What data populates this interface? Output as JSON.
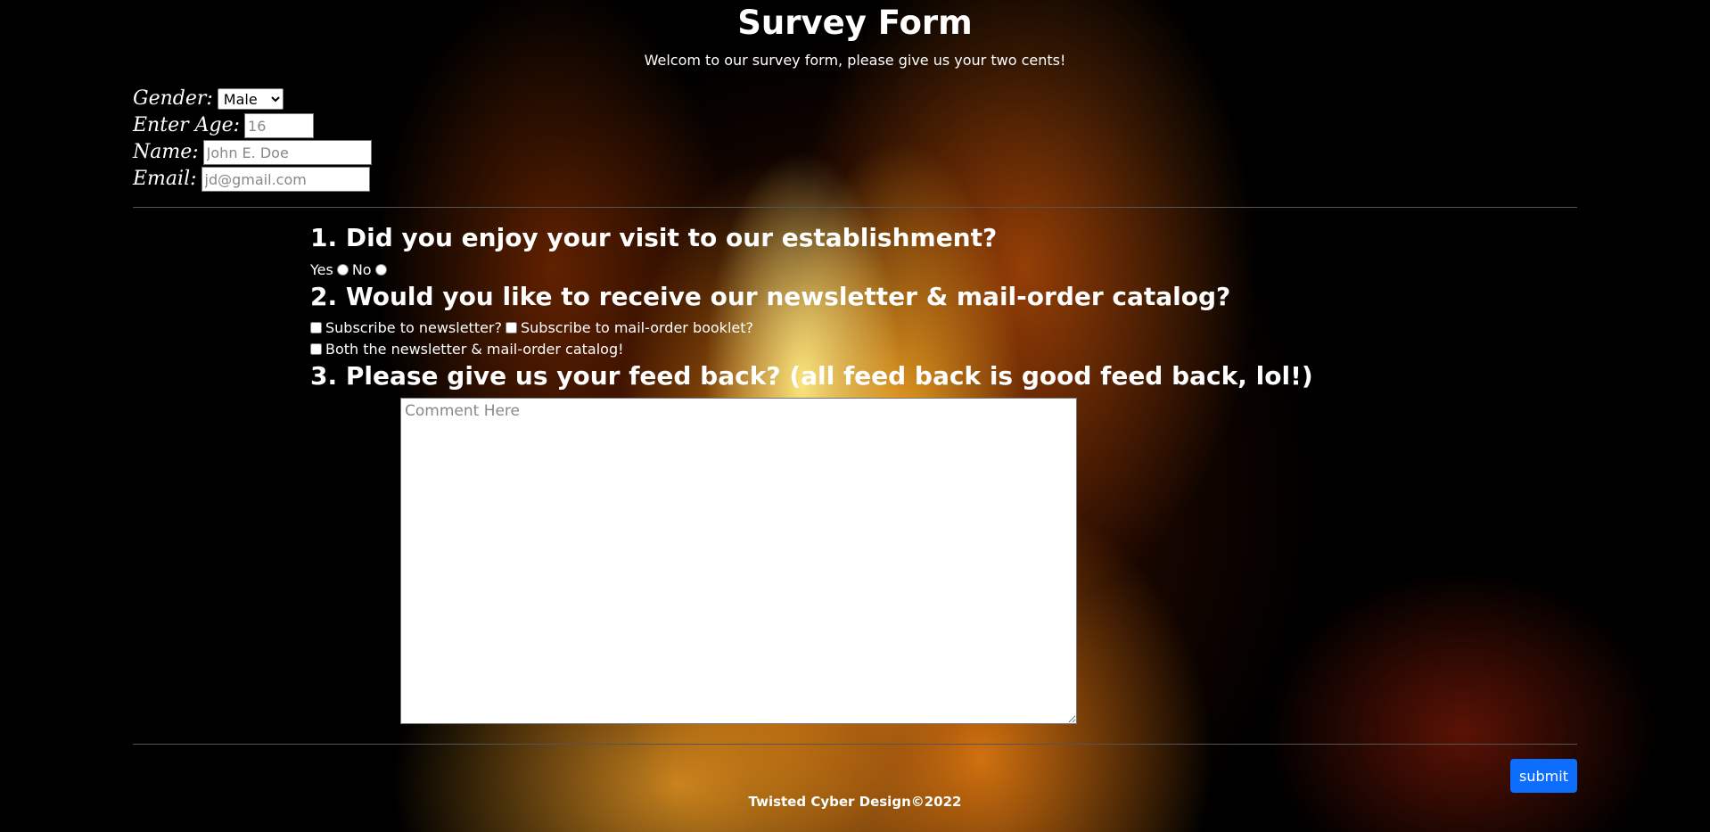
{
  "header": {
    "title": "Survey Form",
    "subtitle": "Welcom to our survey form, please give us your two cents!"
  },
  "personal": {
    "gender_label": "Gender:",
    "gender_value": "Male",
    "age_label": "Enter Age:",
    "age_placeholder": "16",
    "name_label": "Name:",
    "name_placeholder": "John E. Doe",
    "email_label": "Email:",
    "email_placeholder": "jd@gmail.com"
  },
  "questions": {
    "q1": "1. Did you enjoy your visit to our establishment?",
    "q1_yes": "Yes",
    "q1_no": "No",
    "q2": "2. Would you like to receive our newsletter & mail-order catalog?",
    "q2_opt1": "Subscribe to newsletter?",
    "q2_opt2": "Subscribe to mail-order booklet?",
    "q2_opt3": "Both the newsletter & mail-order catalog!",
    "q3": "3. Please give us your feed back? (all feed back is good feed back, lol!)",
    "q3_placeholder": "Comment Here"
  },
  "actions": {
    "submit_label": "submit"
  },
  "footer": {
    "text": "Twisted Cyber Design©2022"
  },
  "colors": {
    "accent": "#0d6efd",
    "text": "#ffffff",
    "background": "#000000"
  }
}
